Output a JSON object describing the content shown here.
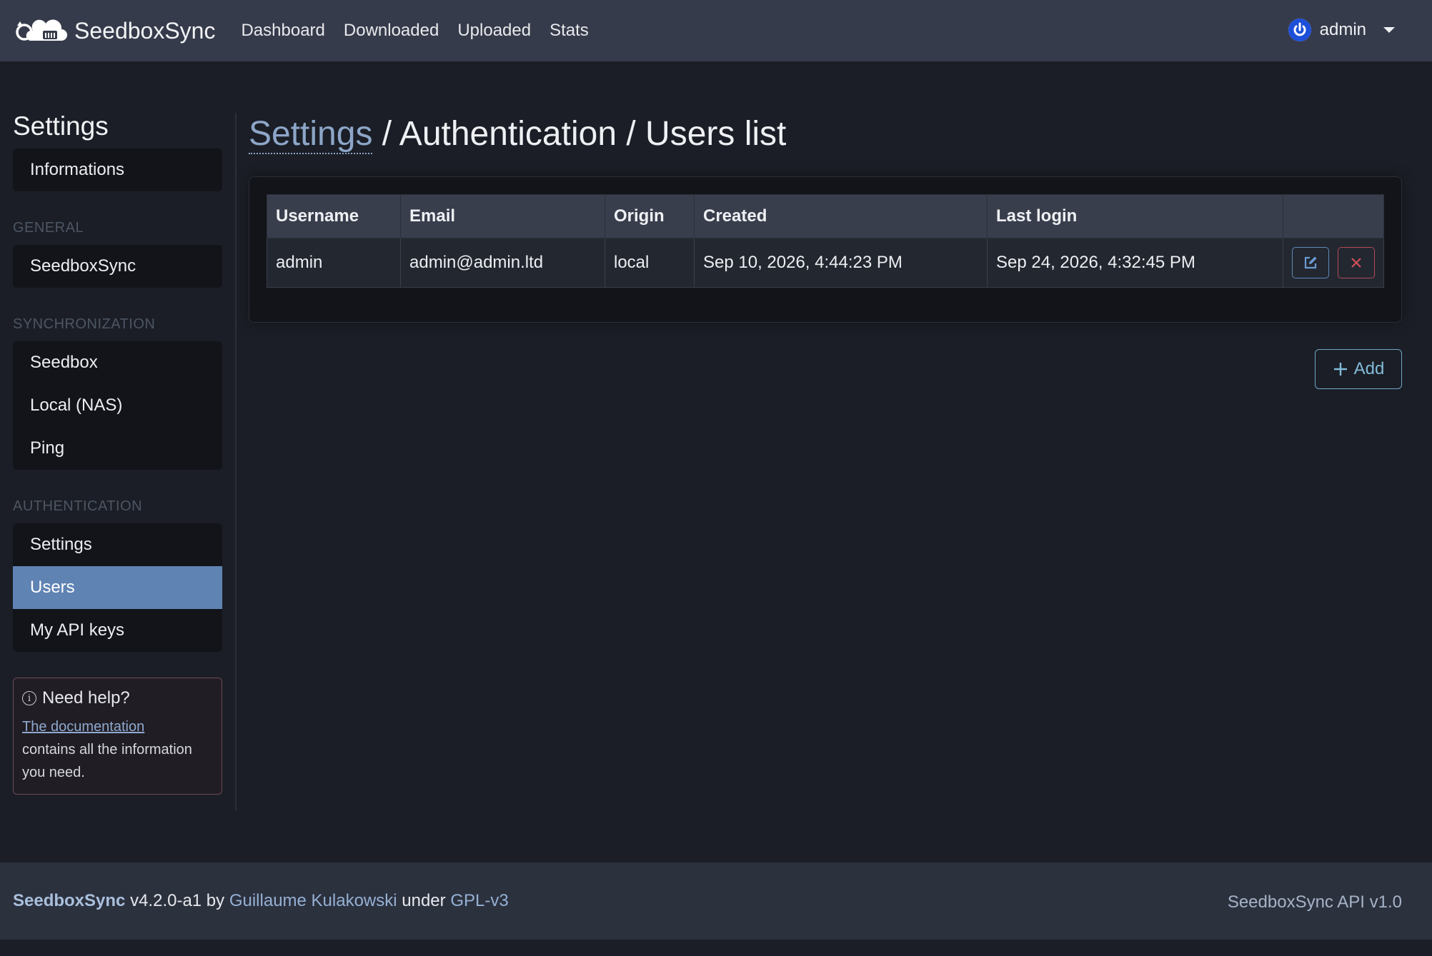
{
  "navbar": {
    "brand": "SeedboxSync",
    "links": [
      "Dashboard",
      "Downloaded",
      "Uploaded",
      "Stats"
    ],
    "user": "admin"
  },
  "sidebar": {
    "title": "Settings",
    "informations": "Informations",
    "sections": {
      "general": {
        "label": "GENERAL",
        "items": [
          "SeedboxSync"
        ]
      },
      "synchronization": {
        "label": "SYNCHRONIZATION",
        "items": [
          "Seedbox",
          "Local (NAS)",
          "Ping"
        ]
      },
      "authentication": {
        "label": "AUTHENTICATION",
        "items": [
          "Settings",
          "Users",
          "My API keys"
        ]
      }
    },
    "active": "Users",
    "help": {
      "title": "Need help?",
      "link": "The documentation",
      "text": "contains all the information you need."
    }
  },
  "main": {
    "breadcrumb": {
      "link": "Settings",
      "rest": " / Authentication / Users list"
    },
    "table": {
      "headers": [
        "Username",
        "Email",
        "Origin",
        "Created",
        "Last login",
        ""
      ],
      "rows": [
        [
          "admin",
          "admin@admin.ltd",
          "local",
          "Sep 10, 2026, 4:44:23 PM",
          "Sep 24, 2026, 4:32:45 PM"
        ]
      ]
    },
    "add_label": "Add"
  },
  "footer": {
    "brand": "SeedboxSync",
    "version": " v4.2.0-a1 by ",
    "author": "Guillaume Kulakowski",
    "under": " under ",
    "license": "GPL-v3",
    "api": "SeedboxSync API v1.0"
  },
  "colors": {
    "navbar_bg": "#363b4b",
    "page_bg": "#1b1e26",
    "active_item": "#5f83b3",
    "add_button": "#82bcd9",
    "delete_button": "#b04b55"
  }
}
